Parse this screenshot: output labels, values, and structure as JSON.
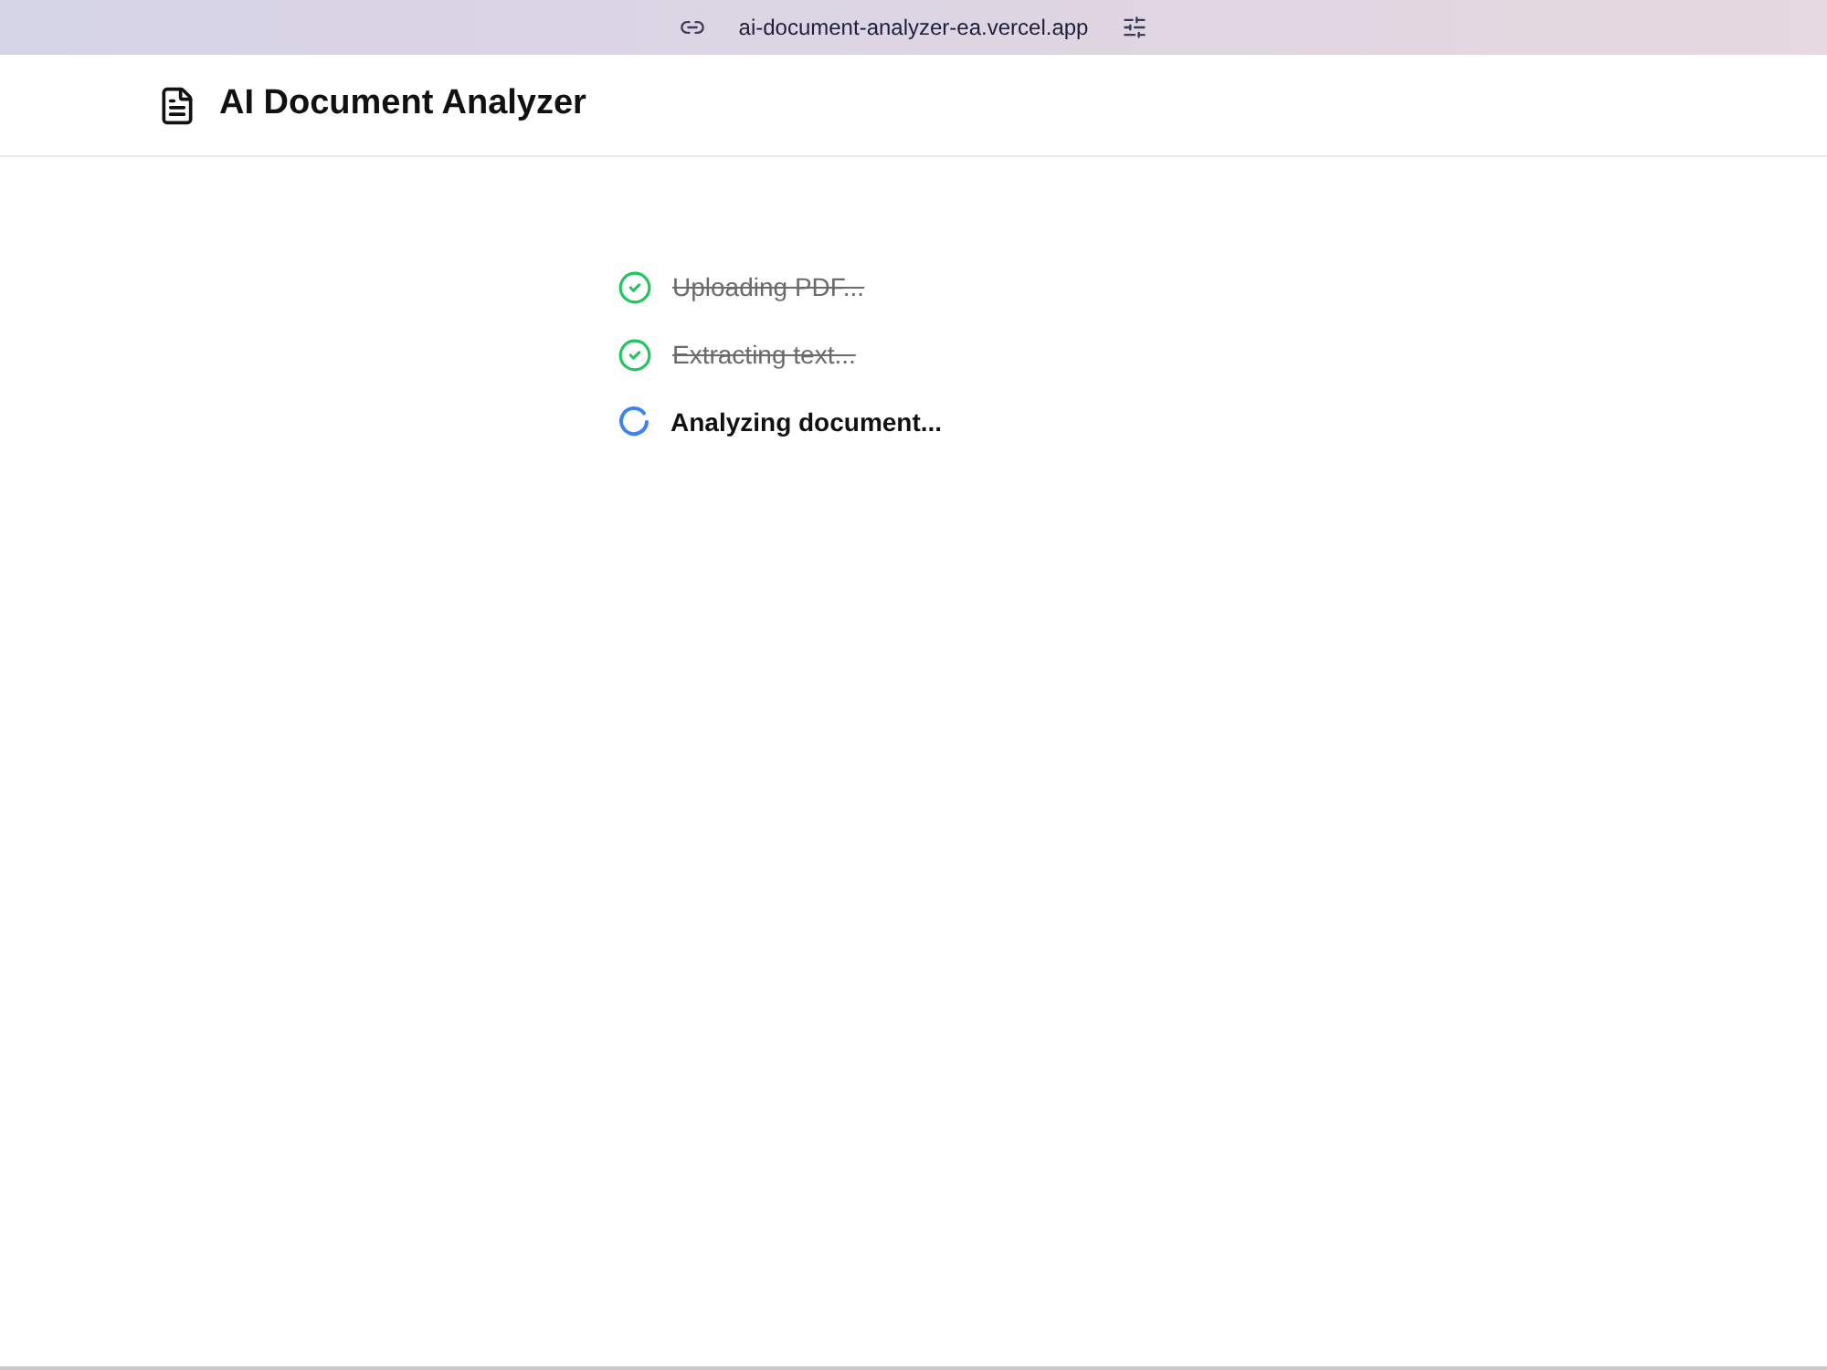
{
  "browser": {
    "url": "ai-document-analyzer-ea.vercel.app"
  },
  "header": {
    "title": "AI Document Analyzer"
  },
  "steps": [
    {
      "label": "Uploading PDF...",
      "done": true
    },
    {
      "label": "Extracting text...",
      "done": true
    },
    {
      "label": "Analyzing document...",
      "done": false
    }
  ]
}
